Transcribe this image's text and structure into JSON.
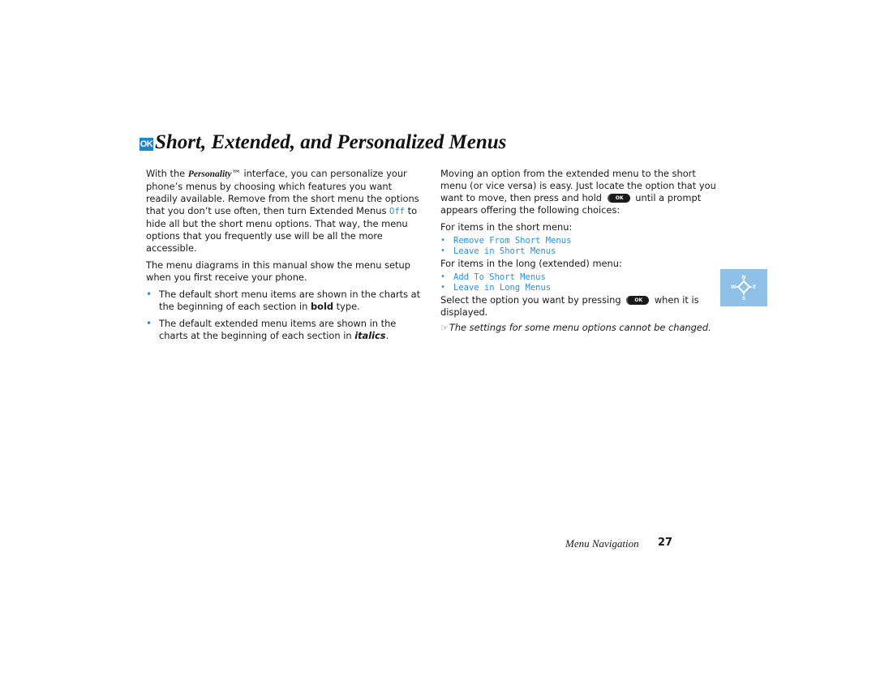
{
  "heading": {
    "icon": "ok-button-icon",
    "icon_label": "OK",
    "title": "Short, Extended, and Personalized Menus"
  },
  "left_column": {
    "p1_part1": "With the ",
    "p1_brand": "Personality",
    "p1_part2": "™ interface, you can personalize your phone’s menus by choosing which features you want readily available. Remove from the short menu the options that you don’t use often, then turn Extended Menus ",
    "p1_lcd": "Off",
    "p1_part3": " to hide all but the short menu options. That way, the menu options that you frequently use will be all the more accessible.",
    "p2": "The menu diagrams in this manual show the menu setup when you first receive your phone.",
    "bullet1_pre": "The default short menu items are shown in the charts at the beginning of each section in ",
    "bullet1_em": "bold",
    "bullet1_post": " type.",
    "bullet2_pre": "The default extended menu items are shown in the charts at the beginning of each section in ",
    "bullet2_em": "italics",
    "bullet2_post": "."
  },
  "right_column": {
    "p1_pre": "Moving an option from the extended menu to the short menu (or vice versa) is easy. Just locate the option that you want to move, then press and hold ",
    "ok_key_label": "OK",
    "p1_post": " until a prompt appears offering the following choices:",
    "short_intro": "For items in the short menu:",
    "short_options": [
      "Remove From Short Menus",
      "Leave in Short Menus"
    ],
    "long_intro": "For items in the long (extended) menu:",
    "long_options": [
      "Add To Short Menus",
      "Leave in Long Menus"
    ],
    "select_pre": "Select the option you want by pressing ",
    "select_post": " when it is displayed.",
    "note_icon": "hand-pointer-icon",
    "note": "The settings for some menu options cannot be changed."
  },
  "nav_key": {
    "icon": "navigation-key-icon",
    "labels": {
      "n": "N",
      "s": "S",
      "e": "E",
      "w": "W"
    },
    "background": "#8fc0e8"
  },
  "footer": {
    "section": "Menu Navigation",
    "page": "27"
  },
  "colors": {
    "accent": "#1a86d0",
    "lcd_text": "#2a8fd9"
  }
}
